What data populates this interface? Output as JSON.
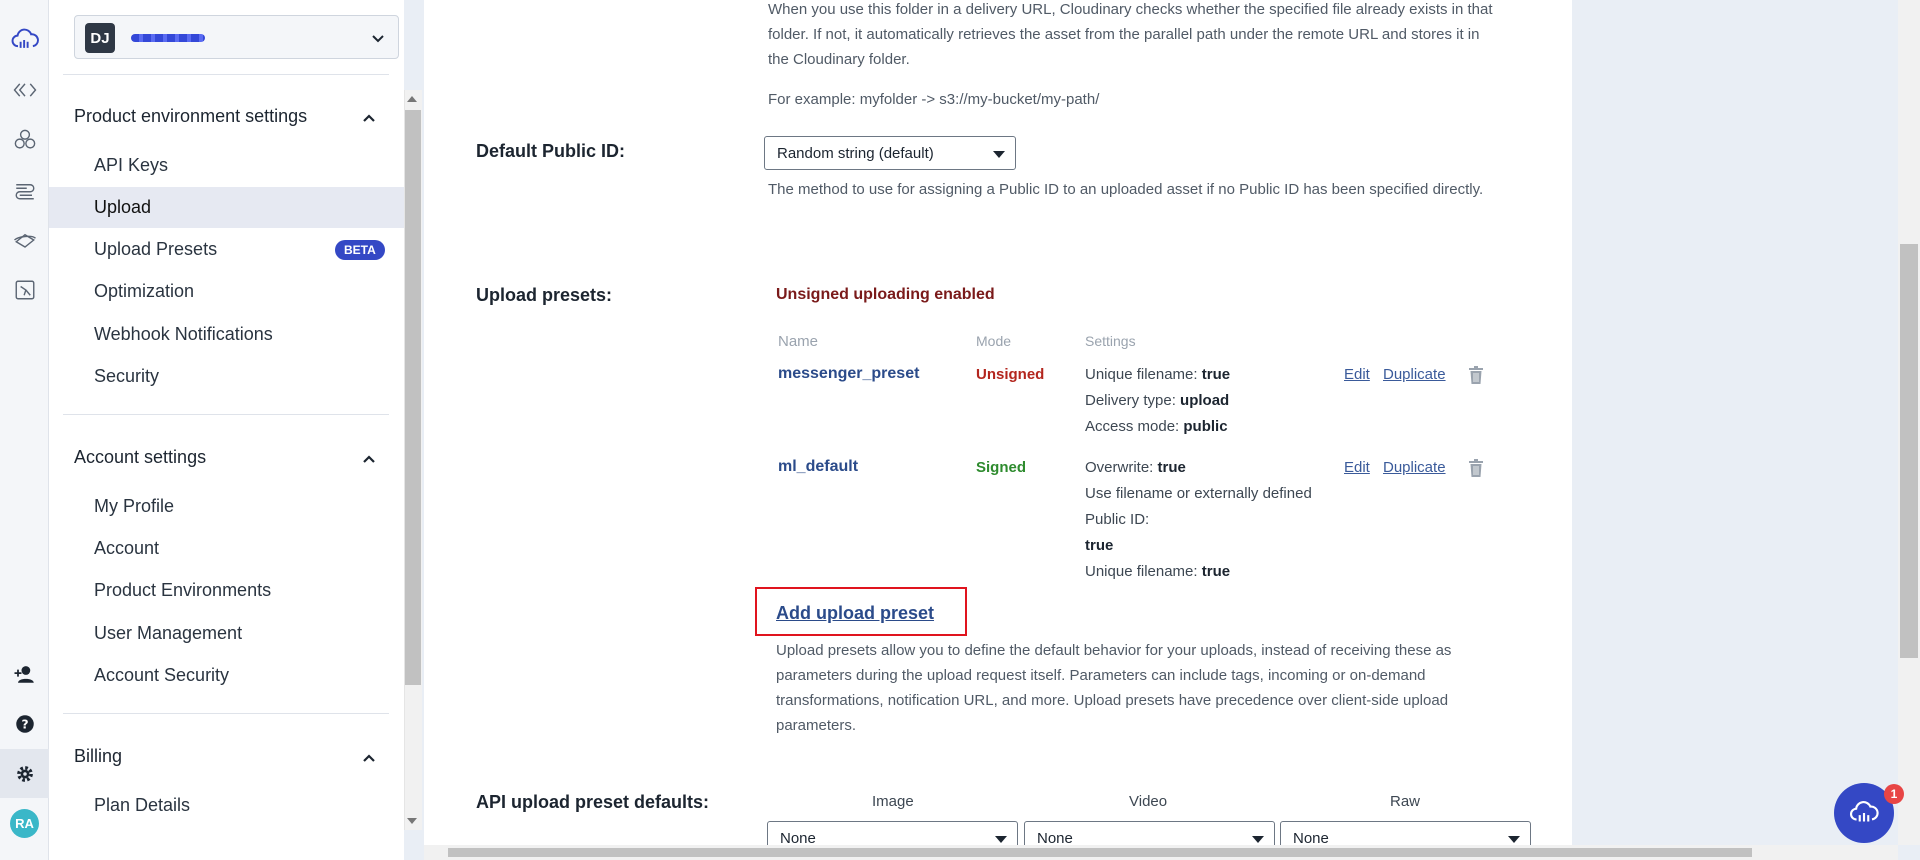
{
  "rail": {
    "icons": [
      "cloud-logo-icon",
      "developer-icon",
      "assets-icon",
      "media-flows-icon",
      "video-icon",
      "migration-icon"
    ],
    "bottom_icons": [
      "add-user-icon",
      "help-icon",
      "settings-icon"
    ],
    "avatar": "RA"
  },
  "sidebar": {
    "env_badge": "DJ",
    "product_env_title": "Product environment settings",
    "product_env_items": [
      {
        "label": "API Keys"
      },
      {
        "label": "Upload"
      },
      {
        "label": "Upload Presets",
        "badge": "BETA"
      },
      {
        "label": "Optimization"
      },
      {
        "label": "Webhook Notifications"
      },
      {
        "label": "Security"
      }
    ],
    "account_title": "Account settings",
    "account_items": [
      {
        "label": "My Profile"
      },
      {
        "label": "Account"
      },
      {
        "label": "Product Environments"
      },
      {
        "label": "User Management"
      },
      {
        "label": "Account Security"
      }
    ],
    "billing_title": "Billing",
    "billing_items": [
      {
        "label": "Plan Details"
      }
    ]
  },
  "main": {
    "folder_desc_1": "When you use this folder in a delivery URL, Cloudinary checks whether the specified file already exists in that",
    "folder_desc_2": "folder. If not, it automatically retrieves the asset from the parallel path under the remote URL and stores it in",
    "folder_desc_3": "the Cloudinary folder.",
    "folder_example": "For example: myfolder -> s3://my-bucket/my-path/",
    "public_id_label": "Default Public ID:",
    "public_id_value": "Random string (default)",
    "public_id_help": "The method to use for assigning a Public ID to an uploaded asset if no Public ID has been specified directly.",
    "presets_label": "Upload presets:",
    "unsigned_status": "Unsigned uploading enabled",
    "table_headers": {
      "name": "Name",
      "mode": "Mode",
      "settings": "Settings"
    },
    "presets": [
      {
        "name": "messenger_preset",
        "mode": "Unsigned",
        "settings": [
          {
            "k": "Unique filename: ",
            "v": "true"
          },
          {
            "k": "Delivery type: ",
            "v": "upload"
          },
          {
            "k": "Access mode: ",
            "v": "public"
          }
        ],
        "edit": "Edit",
        "duplicate": "Duplicate"
      },
      {
        "name": "ml_default",
        "mode": "Signed",
        "settings": [
          {
            "k": "Overwrite: ",
            "v": "true"
          },
          {
            "k": "Use filename or externally defined",
            "v": ""
          },
          {
            "k": "Public ID:",
            "v": ""
          },
          {
            "k": "",
            "v": "true"
          },
          {
            "k": "Unique filename: ",
            "v": "true"
          }
        ],
        "edit": "Edit",
        "duplicate": "Duplicate"
      }
    ],
    "add_preset": "Add upload preset",
    "presets_help_1": "Upload presets allow you to define the default behavior for your uploads, instead of receiving these as",
    "presets_help_2": "parameters during the upload request itself. Parameters can include tags, incoming or on-demand",
    "presets_help_3": "transformations, notification URL, and more. Upload presets have precedence over client-side upload",
    "presets_help_4": "parameters.",
    "api_defaults_label": "API upload preset defaults:",
    "api_defaults": [
      {
        "head": "Image",
        "value": "None"
      },
      {
        "head": "Video",
        "value": "None"
      },
      {
        "head": "Raw",
        "value": "None"
      }
    ]
  },
  "chat": {
    "badge": "1"
  }
}
